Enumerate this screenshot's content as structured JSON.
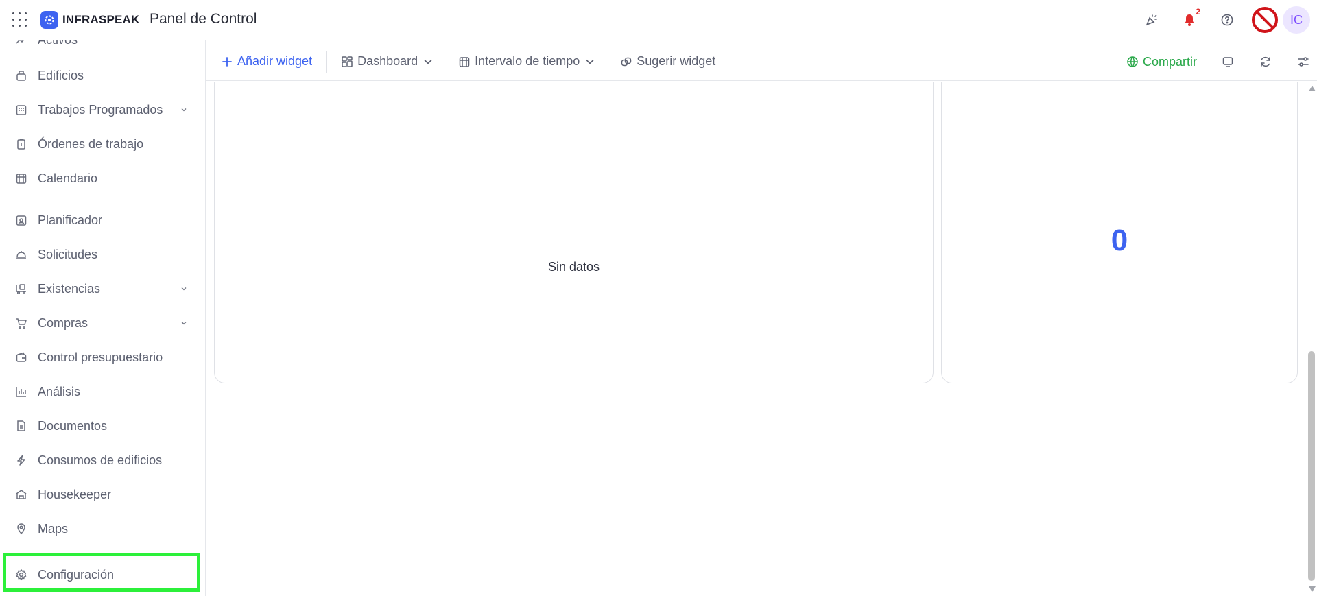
{
  "header": {
    "logo_text": "INFRASPEAK",
    "title": "Panel de Control",
    "notification_count": "2",
    "avatar_initials": "IC",
    "icons": [
      "apps-grid-icon",
      "party-popper-icon",
      "bell-icon",
      "help-icon",
      "blocked-icon"
    ]
  },
  "sidebar": {
    "items": [
      {
        "label": "Activos",
        "icon": "assets-icon"
      },
      {
        "label": "Edificios",
        "icon": "building-icon"
      },
      {
        "label": "Trabajos Programados",
        "icon": "calendar-grid-icon",
        "expandable": true
      },
      {
        "label": "Órdenes de trabajo",
        "icon": "clipboard-icon"
      },
      {
        "label": "Calendario",
        "icon": "calendar-icon"
      },
      {
        "label": "Planificador",
        "icon": "planner-icon"
      },
      {
        "label": "Solicitudes",
        "icon": "service-bell-icon"
      },
      {
        "label": "Existencias",
        "icon": "stock-icon",
        "expandable": true
      },
      {
        "label": "Compras",
        "icon": "cart-icon",
        "expandable": true
      },
      {
        "label": "Control presupuestario",
        "icon": "wallet-icon"
      },
      {
        "label": "Análisis",
        "icon": "bar-chart-icon"
      },
      {
        "label": "Documentos",
        "icon": "document-icon"
      },
      {
        "label": "Consumos de edificios",
        "icon": "lightning-icon"
      },
      {
        "label": "Housekeeper",
        "icon": "housekeeper-icon"
      },
      {
        "label": "Maps",
        "icon": "map-pin-icon"
      },
      {
        "label": "Configuración",
        "icon": "gear-icon"
      }
    ]
  },
  "toolbar": {
    "add_widget": "Añadir widget",
    "dashboard": "Dashboard",
    "time_interval": "Intervalo de tiempo",
    "suggest_widget": "Sugerir widget",
    "share": "Compartir"
  },
  "widgets": {
    "left_empty_text": "Sin datos",
    "right_value": "0"
  },
  "colors": {
    "accent": "#3d63f0",
    "share_green": "#2aa84a",
    "highlight": "#2cf03a",
    "notification_red": "#e12c2c"
  }
}
